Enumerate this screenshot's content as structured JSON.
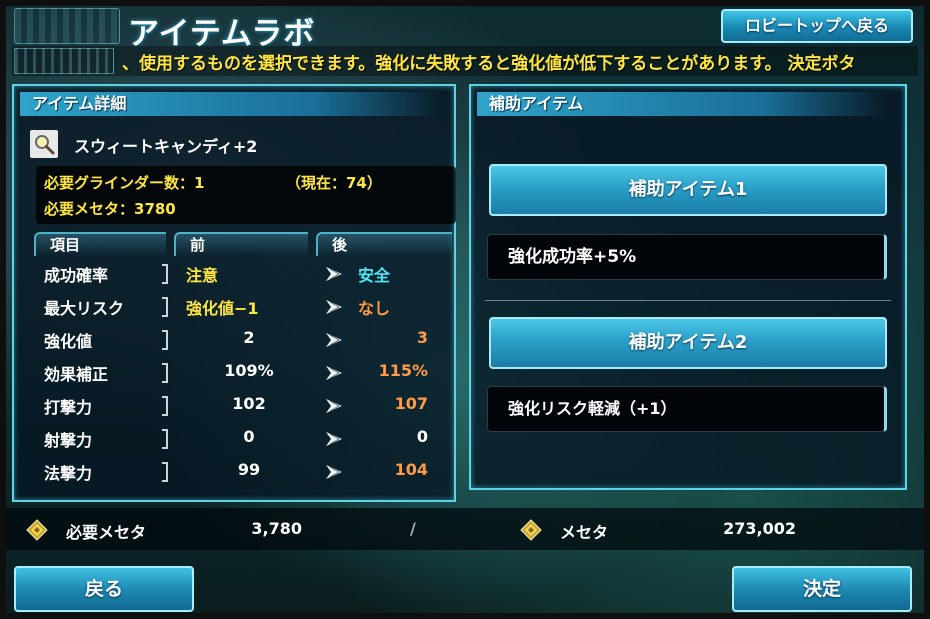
{
  "header": {
    "title": "アイテムラボ",
    "lobby_button": "ロビートップへ戻る",
    "ticker": "、使用するものを選択できます。強化に失敗すると強化値が低下することがあります。 決定ボタ"
  },
  "item_detail": {
    "heading": "アイテム詳細",
    "item_icon": "magnifier-item-icon",
    "item_name": "スウィートキャンディ+2",
    "required_grinders": "必要グラインダー数：1",
    "current_grinders": "（現在：74）",
    "required_meseta": "必要メセタ：3780",
    "columns": {
      "item": "項目",
      "before": "前",
      "after": "後"
    },
    "stats": [
      {
        "label": "成功確率",
        "before": "注意",
        "after": "安全"
      },
      {
        "label": "最大リスク",
        "before": "強化値−1",
        "after": "なし"
      },
      {
        "label": "強化値",
        "before": "2",
        "after": "3"
      },
      {
        "label": "効果補正",
        "before": "109%",
        "after": "115%"
      },
      {
        "label": "打撃力",
        "before": "102",
        "after": "107"
      },
      {
        "label": "射撃力",
        "before": "0",
        "after": "0"
      },
      {
        "label": "法撃力",
        "before": "99",
        "after": "104"
      }
    ]
  },
  "aux_items": {
    "heading": "補助アイテム",
    "slot1_button": "補助アイテム1",
    "slot1_value": "強化成功率+5%",
    "slot2_button": "補助アイテム2",
    "slot2_value": "強化リスク軽減（+1）"
  },
  "meseta_bar": {
    "required_label": "必要メセタ",
    "required_value": "3,780",
    "separator": "/",
    "owned_label": "メセタ",
    "owned_value": "273,002",
    "icon": "meseta-coin-icon"
  },
  "footer": {
    "back_label": "戻る",
    "confirm_label": "決定"
  },
  "colors": {
    "accent": "#5fd3e6",
    "button": "#2a9fc8",
    "yellow_text": "#ffe640",
    "cyan_text": "#4fe8f5",
    "orange_text": "#ff9a48"
  }
}
